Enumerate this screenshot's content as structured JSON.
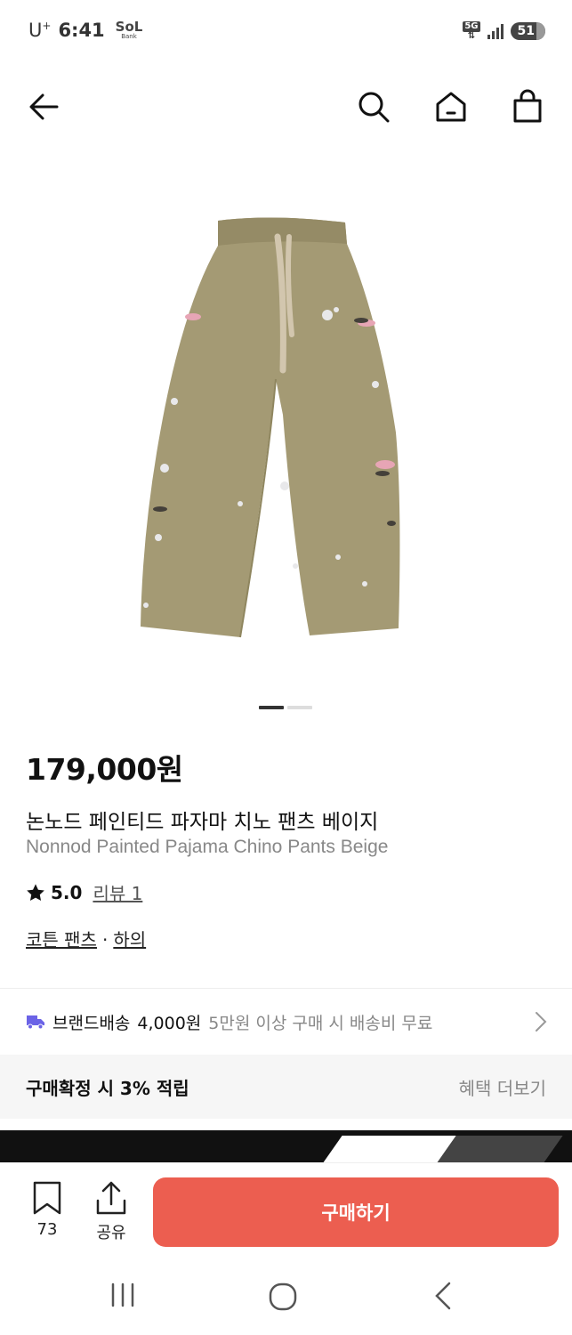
{
  "status_bar": {
    "carrier": "U",
    "carrier_sup": "+",
    "time": "6:41",
    "bank_app_top": "SoL",
    "bank_app_bottom": "Bank",
    "network": "5G",
    "battery": "51"
  },
  "header": {
    "icons": [
      "back-arrow-icon",
      "search-icon",
      "home-icon",
      "shopping-bag-icon"
    ]
  },
  "product": {
    "image_alt_icon": "pants-image",
    "image_color": "#a49a74",
    "carousel_total": 2,
    "carousel_active": 1,
    "price": "179,000원",
    "name_ko": "논노드 페인티드 파자마 치노 팬츠 베이지",
    "name_en": "Nonnod Painted Pajama Chino Pants Beige",
    "rating": "5.0",
    "review_label": "리뷰 1",
    "category_1": "코튼 팬츠",
    "category_sep": "·",
    "category_2": "하의"
  },
  "shipping": {
    "label": "브랜드배송",
    "fee": "4,000원",
    "note": "5만원 이상 구매 시 배송비 무료",
    "icon": "truck-icon",
    "icon_color": "#6b63e6"
  },
  "points": {
    "text": "구매확정 시 3% 적립",
    "more": "혜택 더보기"
  },
  "action_bar": {
    "bookmark_count": "73",
    "share_label": "공유",
    "buy_label": "구매하기",
    "buy_color": "#ec5e50"
  }
}
